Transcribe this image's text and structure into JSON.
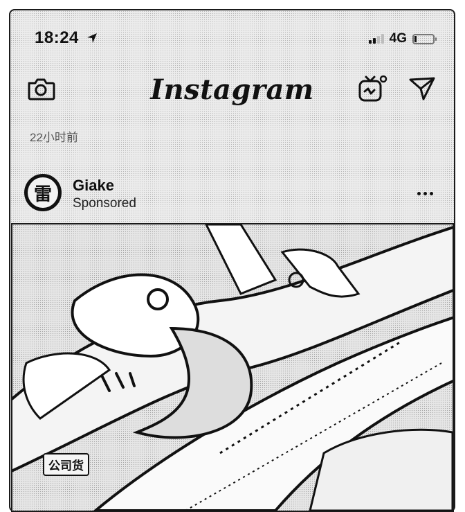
{
  "status_bar": {
    "time": "18:24",
    "network": "4G",
    "icons": [
      "location-arrow-icon",
      "signal-bars-icon",
      "battery-icon"
    ]
  },
  "nav": {
    "brand": "Instagram",
    "icons": [
      "camera-icon",
      "igtv-icon",
      "direct-message-icon"
    ]
  },
  "post": {
    "time_ago": "22小时前",
    "account_name": "Giake",
    "sponsored_label": "Sponsored",
    "avatar_glyph": "雷",
    "more_icon": "more-options-icon",
    "image": {
      "description_icon": "sneaker-photo",
      "watermark_text": "公司货"
    }
  }
}
